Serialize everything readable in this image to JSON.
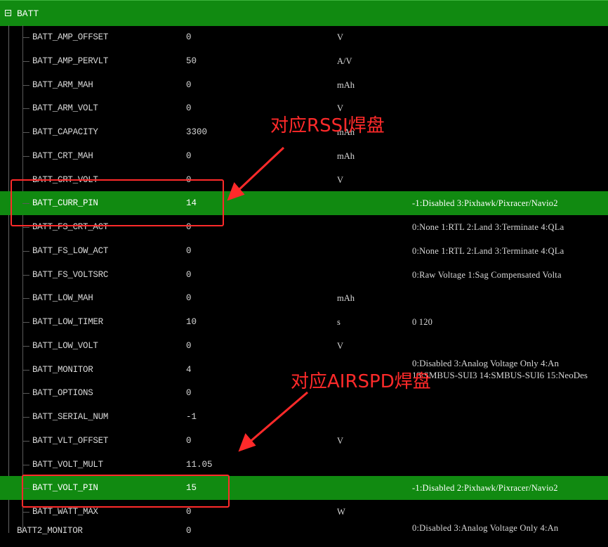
{
  "group": {
    "label": "BATT"
  },
  "rows": [
    {
      "name": "BATT_AMP_OFFSET",
      "value": "0",
      "unit": "V",
      "options": ""
    },
    {
      "name": "BATT_AMP_PERVLT",
      "value": "50",
      "unit": "A/V",
      "options": ""
    },
    {
      "name": "BATT_ARM_MAH",
      "value": "0",
      "unit": "mAh",
      "options": ""
    },
    {
      "name": "BATT_ARM_VOLT",
      "value": "0",
      "unit": "V",
      "options": ""
    },
    {
      "name": "BATT_CAPACITY",
      "value": "3300",
      "unit": "mAh",
      "options": ""
    },
    {
      "name": "BATT_CRT_MAH",
      "value": "0",
      "unit": "mAh",
      "options": ""
    },
    {
      "name": "BATT_CRT_VOLT",
      "value": "0",
      "unit": "V",
      "options": ""
    },
    {
      "name": "BATT_CURR_PIN",
      "value": "14",
      "unit": "",
      "options": "-1:Disabled 3:Pixhawk/Pixracer/Navio2"
    },
    {
      "name": "BATT_FS_CRT_ACT",
      "value": "0",
      "unit": "",
      "options": "0:None 1:RTL 2:Land 3:Terminate 4:QLa"
    },
    {
      "name": "BATT_FS_LOW_ACT",
      "value": "0",
      "unit": "",
      "options": "0:None 1:RTL 2:Land 3:Terminate 4:QLa"
    },
    {
      "name": "BATT_FS_VOLTSRC",
      "value": "0",
      "unit": "",
      "options": "0:Raw Voltage 1:Sag Compensated Volta"
    },
    {
      "name": "BATT_LOW_MAH",
      "value": "0",
      "unit": "mAh",
      "options": ""
    },
    {
      "name": "BATT_LOW_TIMER",
      "value": "10",
      "unit": "s",
      "options": "0 120"
    },
    {
      "name": "BATT_LOW_VOLT",
      "value": "0",
      "unit": "V",
      "options": ""
    },
    {
      "name": "BATT_MONITOR",
      "value": "4",
      "unit": "",
      "options": ""
    },
    {
      "name": "BATT_OPTIONS",
      "value": "0",
      "unit": "",
      "options": ""
    },
    {
      "name": "BATT_SERIAL_NUM",
      "value": "-1",
      "unit": "",
      "options": ""
    },
    {
      "name": "BATT_VLT_OFFSET",
      "value": "0",
      "unit": "V",
      "options": ""
    },
    {
      "name": "BATT_VOLT_MULT",
      "value": "11.05",
      "unit": "",
      "options": ""
    },
    {
      "name": "BATT_VOLT_PIN",
      "value": "15",
      "unit": "",
      "options": "-1:Disabled 2:Pixhawk/Pixracer/Navio2"
    },
    {
      "name": "BATT_WATT_MAX",
      "value": "0",
      "unit": "W",
      "options": ""
    }
  ],
  "monitor_options": {
    "line1": "0:Disabled 3:Analog Voltage Only 4:An",
    "line2": "13:SMBUS-SUI3 14:SMBUS-SUI6 15:NeoDes"
  },
  "partial_row": {
    "name": "BATT2_MONITOR",
    "value": "0",
    "options": "0:Disabled 3:Analog Voltage Only 4:An"
  },
  "annotations": {
    "rssi": "对应RSSI焊盘",
    "airspd": "对应AIRSPD焊盘"
  },
  "colors": {
    "highlight": "#118a11",
    "annotation": "#ff2a2a",
    "background": "#000000"
  }
}
